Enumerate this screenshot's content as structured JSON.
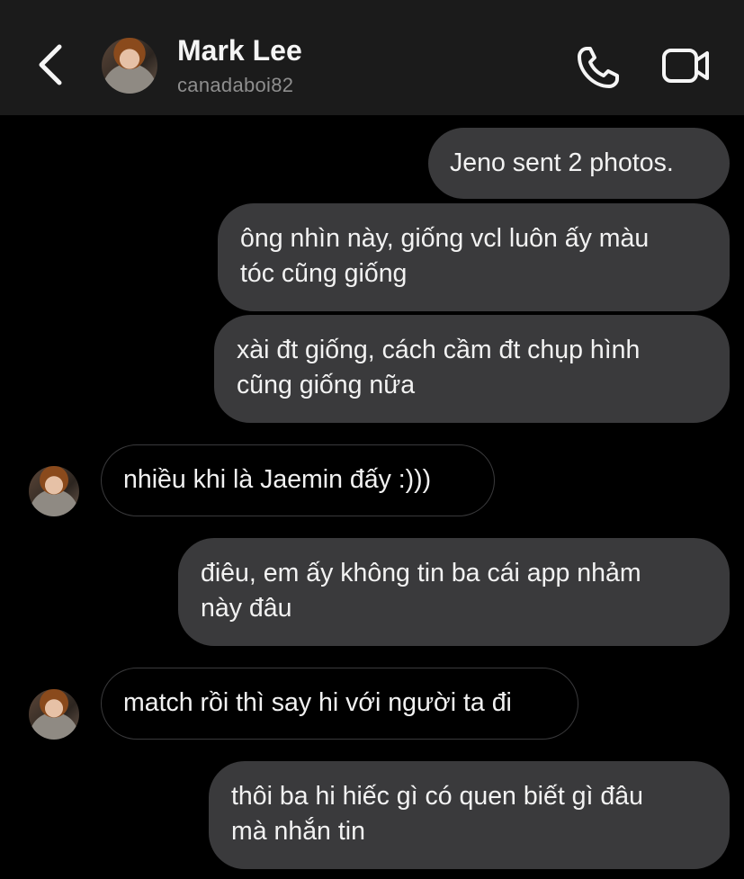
{
  "header": {
    "back_icon": "chevron-left-icon",
    "name": "Mark Lee",
    "username": "canadaboi82",
    "call_icon": "phone-icon",
    "video_icon": "video-camera-icon"
  },
  "messages": [
    {
      "from": "me",
      "lines": [
        "Jeno sent 2 photos."
      ]
    },
    {
      "from": "me",
      "lines": [
        "ông nhìn này, giống vcl luôn ấy màu",
        "tóc cũng giống"
      ]
    },
    {
      "from": "me",
      "lines": [
        "xài đt giống, cách cầm đt chụp hình",
        "cũng giống nữa"
      ]
    },
    {
      "from": "them",
      "lines": [
        "nhiều khi là Jaemin đấy :)))"
      ]
    },
    {
      "from": "me",
      "lines": [
        "điêu, em ấy không tin ba cái app nhảm",
        "này đâu"
      ]
    },
    {
      "from": "them",
      "lines": [
        "match rồi thì say hi với người ta đi"
      ]
    },
    {
      "from": "me",
      "lines": [
        "thôi ba hi hiếc gì có quen biết gì đâu",
        "mà nhắn tin"
      ]
    }
  ],
  "colors": {
    "header_bg": "#1b1b1b",
    "sent_bubble": "#3a3a3c",
    "received_border": "#3a3a3c",
    "username": "#8e8e8e"
  }
}
